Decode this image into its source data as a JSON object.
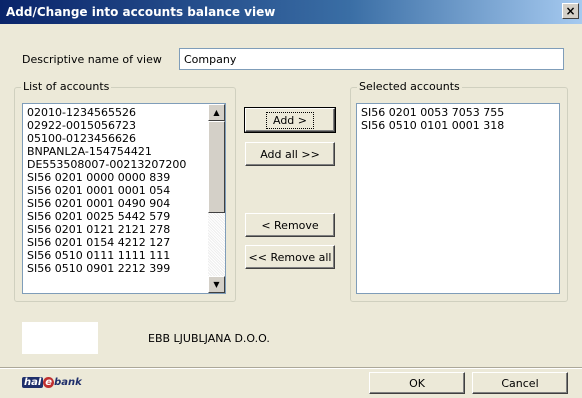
{
  "window": {
    "title": "Add/Change into accounts balance view",
    "close": "×"
  },
  "view_name": {
    "label": "Descriptive name of view",
    "value": "Company"
  },
  "accounts": {
    "title": "List of accounts",
    "items": [
      "02010-1234565526",
      "02922-0015056723",
      "05100-0123456626",
      "BNPANL2A-154754421",
      "DE553508007-00213207200",
      "SI56 0201 0000 0000 839",
      "SI56 0201 0001 0001 054",
      "SI56 0201 0001 0490 904",
      "SI56 0201 0025 5442 579",
      "SI56 0201 0121 2121 278",
      "SI56 0201 0154 4212 127",
      "SI56 0510 0111 1111 111",
      "SI56 0510 0901 2212 399"
    ]
  },
  "selected": {
    "title": "Selected accounts",
    "items": [
      "SI56 0201 0053 7053 755",
      "SI56 0510 0101 0001 318"
    ]
  },
  "buttons": {
    "add": "Add >",
    "add_all": "Add all >>",
    "remove": "< Remove",
    "remove_all": "<< Remove all",
    "ok": "OK",
    "cancel": "Cancel"
  },
  "company_name": "EBB LJUBLJANA D.O.O.",
  "logo": {
    "part1": "hal",
    "part2": "e",
    "part3": "bank"
  },
  "colors": {
    "title_start": "#0a246a",
    "title_end": "#a6caf0",
    "face": "#ece9d8"
  }
}
